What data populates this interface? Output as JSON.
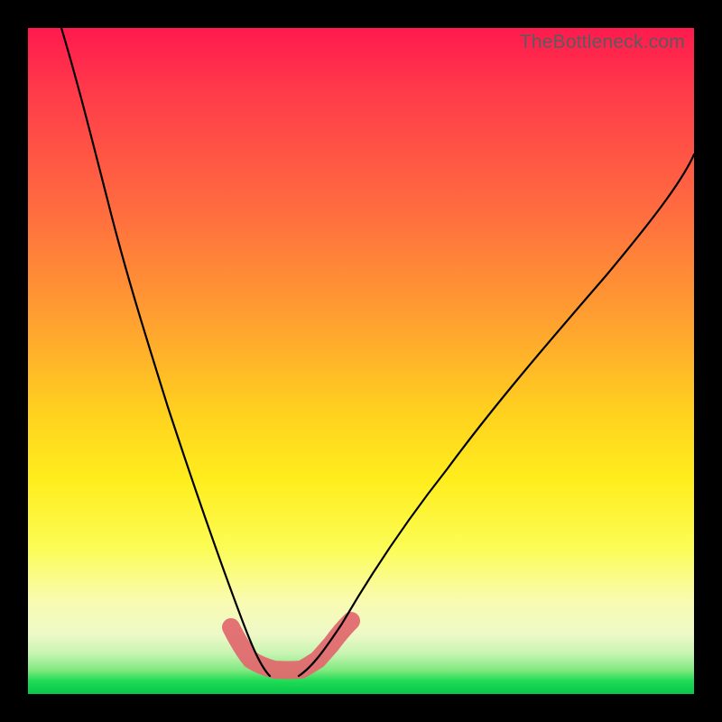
{
  "watermark": "TheBottleneck.com",
  "colors": {
    "frame": "#000000",
    "curve": "#000000",
    "band": "#e06a6f",
    "gradient_top": "#ff1a4e",
    "gradient_bottom": "#07c64a"
  },
  "chart_data": {
    "type": "line",
    "title": "",
    "xlabel": "",
    "ylabel": "",
    "xlim": [
      0,
      100
    ],
    "ylim": [
      0,
      100
    ],
    "grid": false,
    "legend": false,
    "note": "No axis ticks or numeric labels are rendered in the image; x/y are relative percentages. y=100 corresponds to the top (worst/red), y=0 to the bottom (best/green). The curve forms a V with its minimum (optimal point) near x≈35–42.",
    "series": [
      {
        "name": "curve-left",
        "x": [
          5,
          8,
          11,
          14,
          17,
          20,
          23,
          26,
          29,
          32,
          33.5,
          35
        ],
        "y": [
          100,
          89,
          77,
          65,
          54,
          43,
          33,
          24,
          16,
          9,
          6,
          4
        ]
      },
      {
        "name": "curve-right",
        "x": [
          42,
          44,
          47,
          51,
          56,
          62,
          68,
          75,
          82,
          90,
          98,
          100
        ],
        "y": [
          4,
          6,
          9,
          14,
          21,
          29,
          38,
          48,
          58,
          69,
          79,
          82
        ]
      },
      {
        "name": "optimal-band",
        "x": [
          30.5,
          32,
          33.5,
          35,
          37,
          39,
          41,
          42,
          43.5,
          45.5,
          47,
          48.5
        ],
        "y": [
          10,
          7,
          5.2,
          4.2,
          3.6,
          3.4,
          3.6,
          4.2,
          5.2,
          7.5,
          9.5,
          11
        ],
        "style": "thick-salmon"
      }
    ]
  }
}
